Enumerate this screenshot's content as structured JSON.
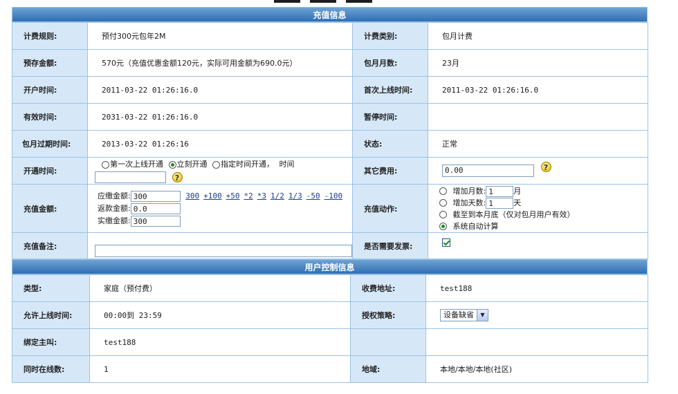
{
  "recharge": {
    "title": "充值信息",
    "billing_rule_label": "计费规则:",
    "billing_rule_value": "预付300元包年2M",
    "billing_category_label": "计费类别:",
    "billing_category_value": "包月计费",
    "deposit_label": "预存金额:",
    "deposit_value": "570元（充值优惠金额120元，实际可用金额为690.0元）",
    "months_label": "包月月数:",
    "months_value": "23月",
    "open_time_label": "开户时间:",
    "open_time_value": "2011-03-22 01:26:16.0",
    "first_online_label": "首次上线时间:",
    "first_online_value": "2011-03-22 01:26:16.0",
    "valid_time_label": "有效时间:",
    "valid_time_value": "2031-03-22 01:26:16.0",
    "pause_time_label": "暂停时间:",
    "pause_time_value": "",
    "expire_label": "包月过期时间:",
    "expire_value": "2013-03-22 01:26:16",
    "status_label": "状态:",
    "status_value": "正常",
    "activation_label": "开通时间:",
    "activation_options": [
      "第一次上线开通",
      "立刻开通",
      "指定时间开通，"
    ],
    "activation_selected": 1,
    "activation_time_label": "时间",
    "activation_time_value": "",
    "other_fee_label": "其它费用:",
    "other_fee_value": "0.00",
    "amount_label": "充值金额:",
    "due_label": "应缴金额:",
    "due_value": "300",
    "refund_label": "返款金额:",
    "refund_value": "0.0",
    "paid_label": "实缴金额:",
    "paid_value": "300",
    "quick_amounts": [
      "300",
      "+100",
      "+50",
      "*2",
      "*3",
      "1/2",
      "1/3",
      "-50",
      "-100"
    ],
    "action_label": "充值动作:",
    "action_add_months": "增加月数:",
    "action_add_months_value": "1",
    "action_add_months_unit": "月",
    "action_add_days": "增加天数:",
    "action_add_days_value": "1",
    "action_add_days_unit": "天",
    "action_month_end": "截至到本月底（仅对包月用户有效）",
    "action_auto": "系统自动计算",
    "remark_label": "充值备注:",
    "remark_value": "",
    "invoice_label": "是否需要发票:",
    "invoice_checked": true
  },
  "user_control": {
    "title": "用户控制信息",
    "type_label": "类型:",
    "type_value": "家庭（预付费）",
    "charge_address_label": "收费地址:",
    "charge_address_value": "test188",
    "allowed_time_label": "允许上线时间:",
    "allowed_time_value": "00:00到 23:59",
    "auth_policy_label": "授权策略:",
    "auth_policy_value": "设备缺省",
    "bind_caller_label": "绑定主叫:",
    "bind_caller_value": "test188",
    "concurrent_label": "同时在线数:",
    "concurrent_value": "1",
    "region_label": "地域:",
    "region_value": "本地/本地/本地(社区)"
  },
  "icons": {
    "help": "help-icon",
    "checkbox": "checkbox-icon",
    "dropdown": "chevron-down-icon"
  },
  "colors": {
    "header_bg": "#3a78b8",
    "label_bg": "#d6e8f8",
    "border": "#9ac2e6",
    "radio_fill": "#1a8a1a"
  }
}
